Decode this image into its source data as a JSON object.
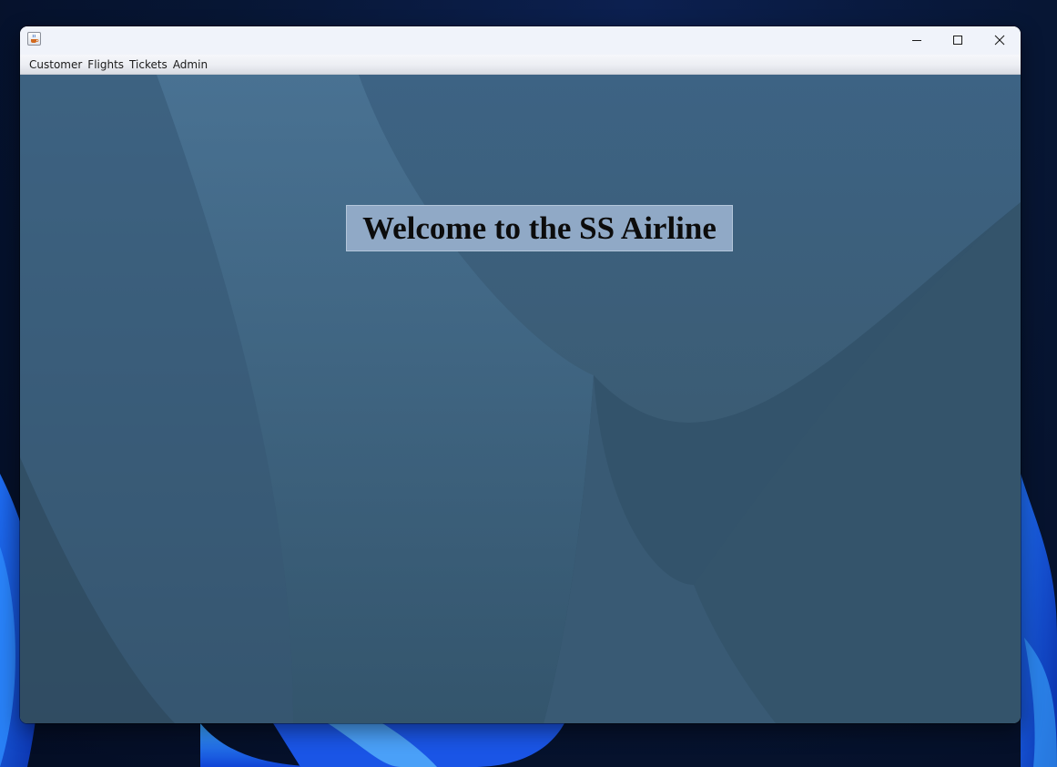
{
  "window": {
    "title": "",
    "app_icon": "java-cup-icon",
    "controls": {
      "minimize_icon": "minimize-icon",
      "maximize_icon": "maximize-icon",
      "close_icon": "close-icon"
    }
  },
  "menubar": {
    "items": [
      {
        "label": "Customer"
      },
      {
        "label": "Flights"
      },
      {
        "label": "Tickets"
      },
      {
        "label": "Admin"
      }
    ]
  },
  "main": {
    "welcome_text": "Welcome to the SS Airline"
  },
  "colors": {
    "content_background": "#3a5b75",
    "banner_background": "#90a9c6",
    "titlebar": "#f0f3fa"
  }
}
